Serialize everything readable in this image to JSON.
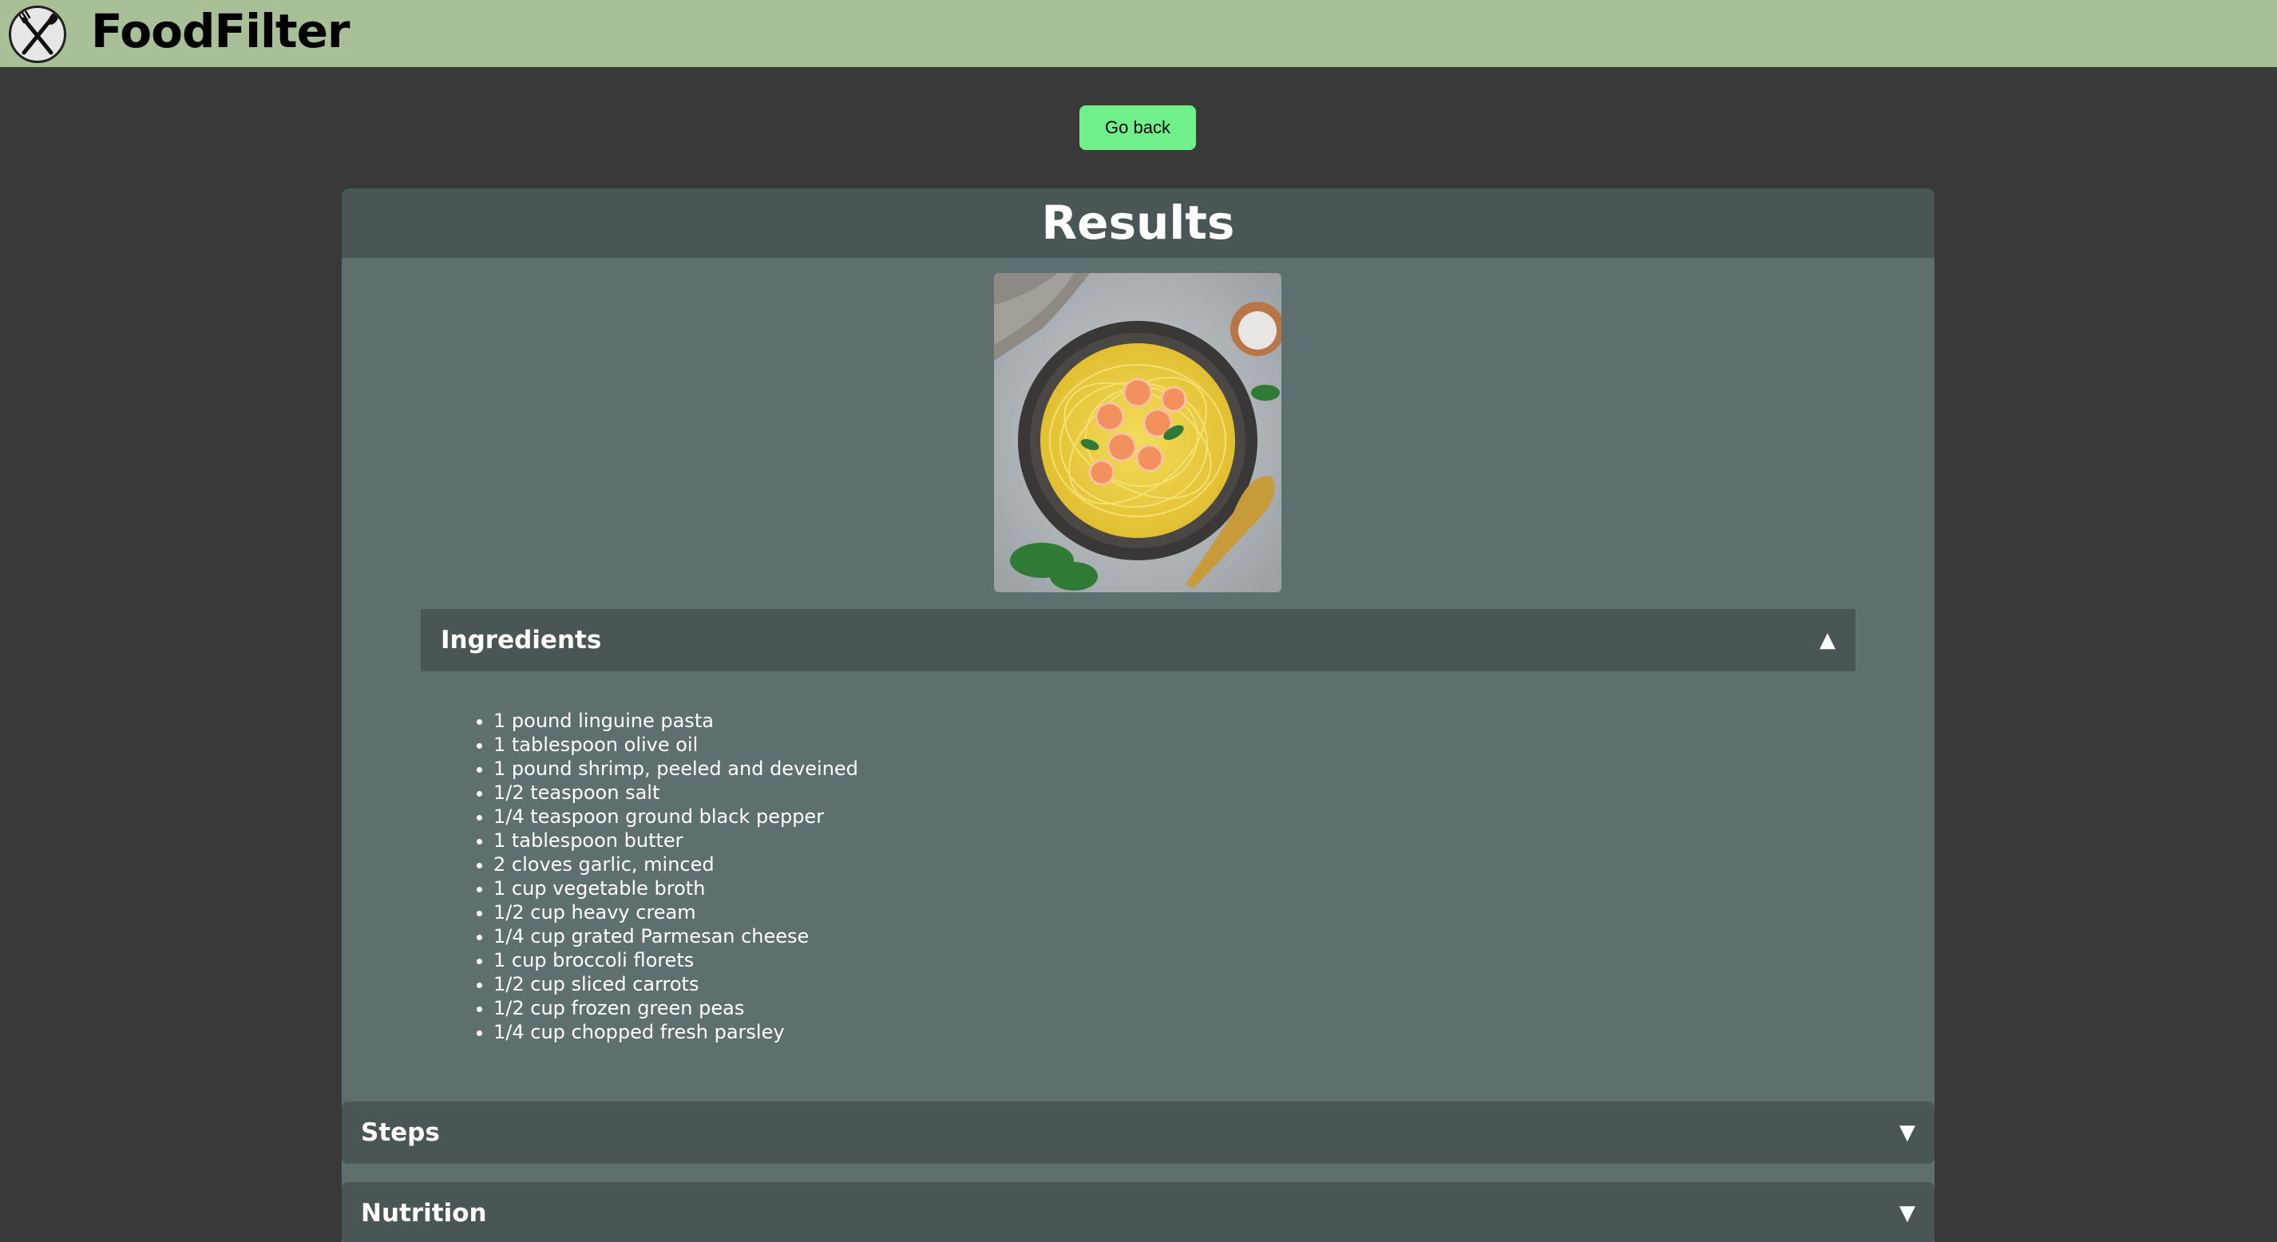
{
  "header": {
    "brand": "FoodFilter",
    "logo_icon": "fork-knife-icon",
    "colors": {
      "bar": "#a8bf98"
    }
  },
  "actions": {
    "go_back_label": "Go back"
  },
  "results": {
    "title": "Results",
    "image_icon": "shrimp-pasta-dish-image",
    "sections": {
      "ingredients": {
        "label": "Ingredients",
        "arrow": "▲",
        "items": [
          "1 pound linguine pasta",
          "1 tablespoon olive oil",
          "1 pound shrimp, peeled and deveined",
          "1/2 teaspoon salt",
          "1/4 teaspoon ground black pepper",
          "1 tablespoon butter",
          "2 cloves garlic, minced",
          "1 cup vegetable broth",
          "1/2 cup heavy cream",
          "1/4 cup grated Parmesan cheese",
          "1 cup broccoli florets",
          "1/2 cup sliced carrots",
          "1/2 cup frozen green peas",
          "1/4 cup chopped fresh parsley"
        ]
      },
      "steps": {
        "label": "Steps",
        "arrow": "▼"
      },
      "nutrition": {
        "label": "Nutrition",
        "arrow": "▼"
      }
    }
  }
}
